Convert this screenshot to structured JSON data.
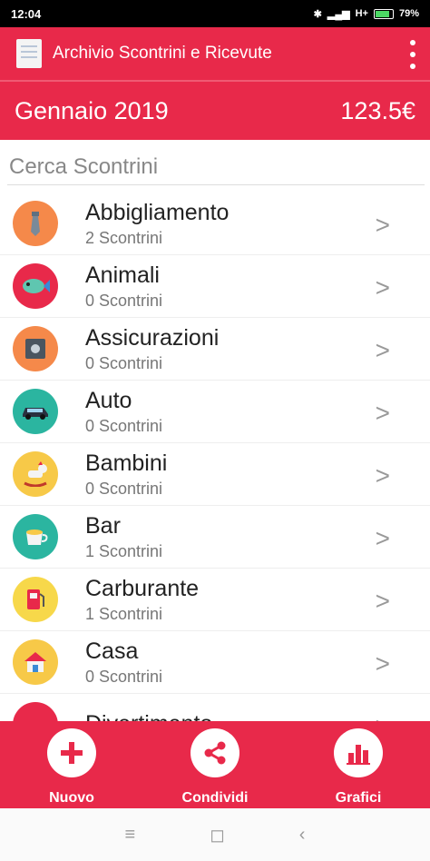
{
  "status_bar": {
    "time": "12:04",
    "network": "H+",
    "battery": "79%"
  },
  "app_bar": {
    "title": "Archivio Scontrini e Ricevute"
  },
  "month": {
    "label": "Gennaio 2019",
    "total": "123.5€"
  },
  "search": {
    "placeholder": "Cerca Scontrini"
  },
  "categories": [
    {
      "name": "Abbigliamento",
      "count": "2 Scontrini",
      "color": "#f5894a",
      "icon": "tie-icon"
    },
    {
      "name": "Animali",
      "count": "0 Scontrini",
      "color": "#e8294a",
      "icon": "fish-icon"
    },
    {
      "name": "Assicurazioni",
      "count": "0 Scontrini",
      "color": "#f5894a",
      "icon": "safe-icon"
    },
    {
      "name": "Auto",
      "count": "0 Scontrini",
      "color": "#2bb5a0",
      "icon": "car-icon"
    },
    {
      "name": "Bambini",
      "count": "0 Scontrini",
      "color": "#f7c948",
      "icon": "rocking-horse-icon"
    },
    {
      "name": "Bar",
      "count": "1 Scontrini",
      "color": "#2bb5a0",
      "icon": "coffee-icon"
    },
    {
      "name": "Carburante",
      "count": "1 Scontrini",
      "color": "#f7d84a",
      "icon": "fuel-pump-icon"
    },
    {
      "name": "Casa",
      "count": "0 Scontrini",
      "color": "#f7c948",
      "icon": "house-icon"
    },
    {
      "name": "Divertimento",
      "count": "",
      "color": "#e8294a",
      "icon": "fun-icon"
    }
  ],
  "bottom_actions": [
    {
      "label": "Nuovo",
      "icon": "plus-icon"
    },
    {
      "label": "Condividi",
      "icon": "share-icon"
    },
    {
      "label": "Grafici",
      "icon": "chart-icon"
    }
  ],
  "nav": {
    "menu": "≡",
    "home": "◻",
    "back": "‹"
  },
  "colors": {
    "primary": "#e8294a",
    "white": "#ffffff"
  }
}
